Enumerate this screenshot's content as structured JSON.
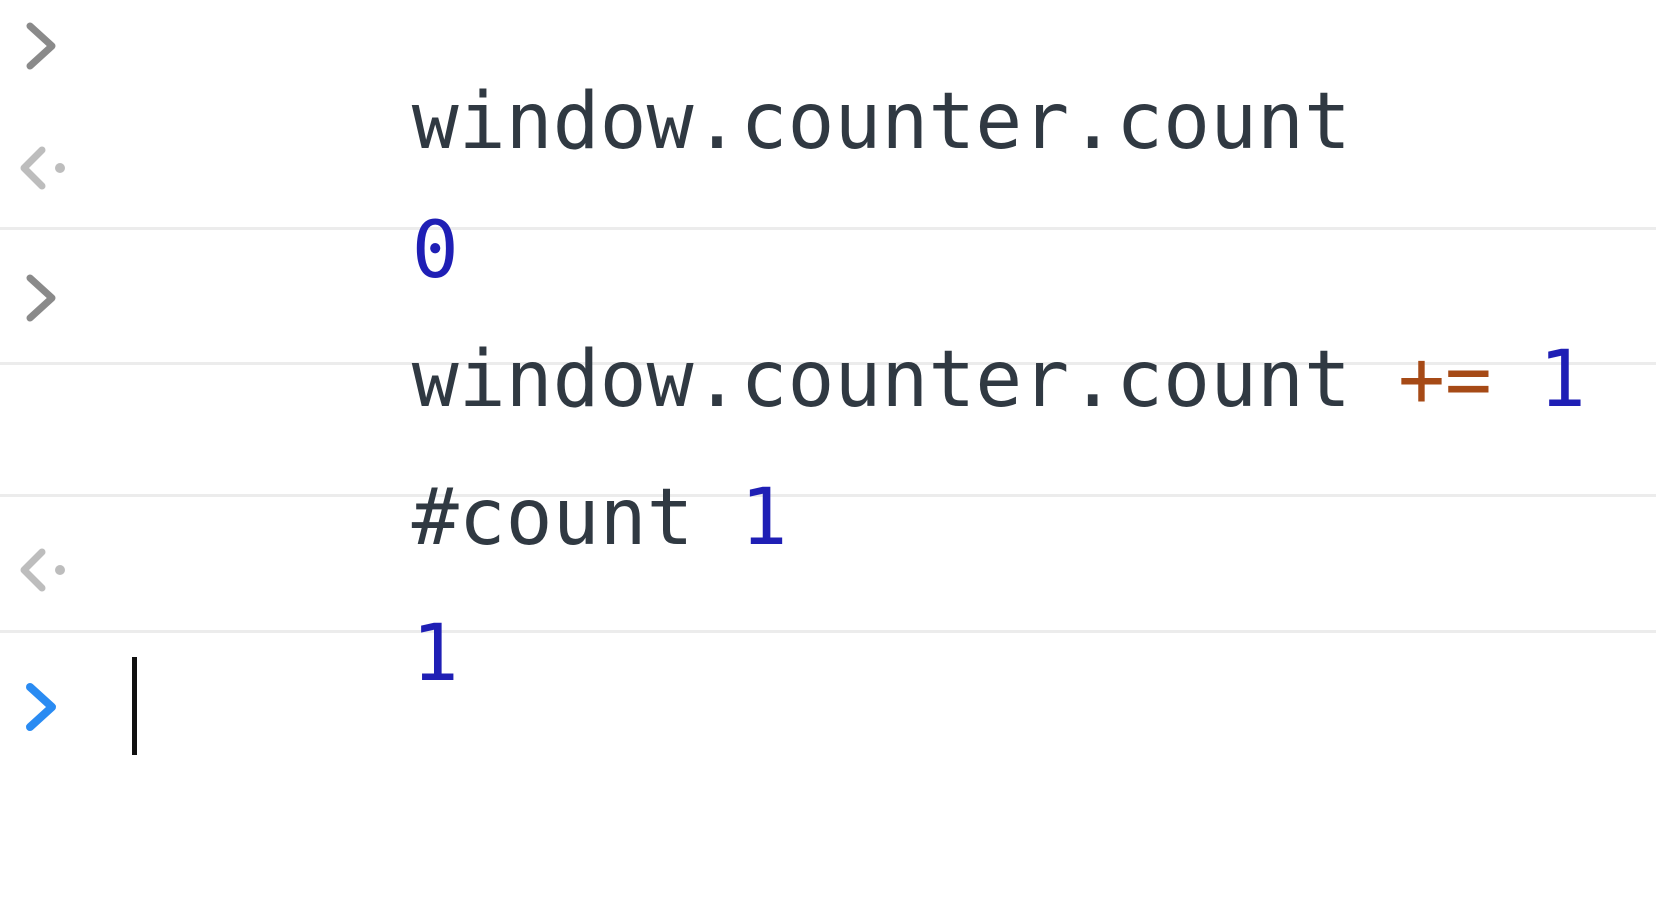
{
  "console": {
    "entries": [
      {
        "kind": "input",
        "gutter_icon": "input-chevron-icon",
        "text": "window.counter.count"
      },
      {
        "kind": "result",
        "gutter_icon": "result-arrow-icon",
        "value": "0"
      },
      {
        "kind": "input",
        "gutter_icon": "input-chevron-icon",
        "expression": "window.counter.count",
        "operator": "+=",
        "operand": "1"
      },
      {
        "kind": "log",
        "label": "#count",
        "value": "1"
      },
      {
        "kind": "result",
        "gutter_icon": "result-arrow-icon",
        "value": "1"
      }
    ],
    "prompt": {
      "gutter_icon": "prompt-chevron-icon",
      "value": ""
    },
    "colors": {
      "text": "#303942",
      "number": "#1f1fb5",
      "operator": "#a64a16",
      "gutter_icon": "#8a8a8a",
      "result_icon": "#bdbdbd",
      "prompt_icon": "#2a8bf2",
      "divider": "#ececec"
    }
  }
}
